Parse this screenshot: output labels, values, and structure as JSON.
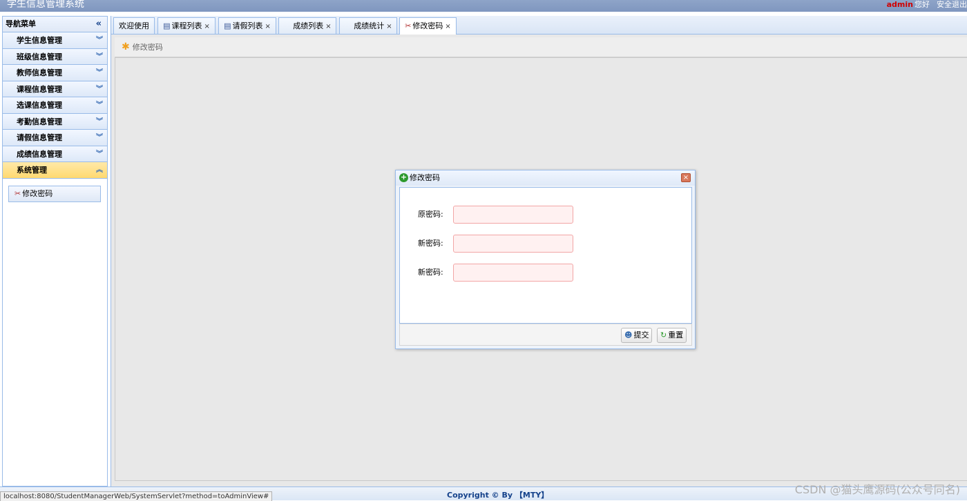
{
  "header": {
    "title": "学生信息管理系统",
    "user": "admin",
    "greeting": "您好",
    "logout": "安全退出"
  },
  "nav": {
    "title": "导航菜单",
    "items": [
      {
        "label": "学生信息管理"
      },
      {
        "label": "班级信息管理"
      },
      {
        "label": "教师信息管理"
      },
      {
        "label": "课程信息管理"
      },
      {
        "label": "选课信息管理"
      },
      {
        "label": "考勤信息管理"
      },
      {
        "label": "请假信息管理"
      },
      {
        "label": "成绩信息管理"
      },
      {
        "label": "系统管理"
      }
    ],
    "active_index": 8,
    "submenu": {
      "label": "修改密码",
      "icon": "tools-icon"
    }
  },
  "tabs": [
    {
      "label": "欢迎使用",
      "closable": false,
      "icon": ""
    },
    {
      "label": "课程列表",
      "closable": true,
      "icon": "book-icon"
    },
    {
      "label": "请假列表",
      "closable": true,
      "icon": "book-icon"
    },
    {
      "label": "成绩列表",
      "closable": true,
      "icon": ""
    },
    {
      "label": "成绩统计",
      "closable": true,
      "icon": ""
    },
    {
      "label": "修改密码",
      "closable": true,
      "icon": "tools-icon",
      "active": true
    }
  ],
  "toolbar": {
    "label": "修改密码",
    "icon": "star-icon"
  },
  "dialog": {
    "title": "修改密码",
    "fields": [
      {
        "label": "原密码:",
        "value": "",
        "placeholder": ""
      },
      {
        "label": "新密码:",
        "value": "",
        "placeholder": ""
      },
      {
        "label": "新密码:",
        "value": "",
        "placeholder": ""
      }
    ],
    "submit_label": "提交",
    "reset_label": "重置"
  },
  "footer": {
    "status_url": "localhost:8080/StudentManagerWeb/SystemServlet?method=toAdminView#",
    "copyright": "Copyright © By 【MTY】",
    "watermark": "CSDN @猫头鹰源码(公众号同名)"
  },
  "colors": {
    "header_bg": "#7f96bf",
    "border": "#99bbe8",
    "active_nav": "#ffd970",
    "admin_text": "#d00000",
    "input_bg": "#fff1f1",
    "input_border": "#f2a5a5"
  }
}
